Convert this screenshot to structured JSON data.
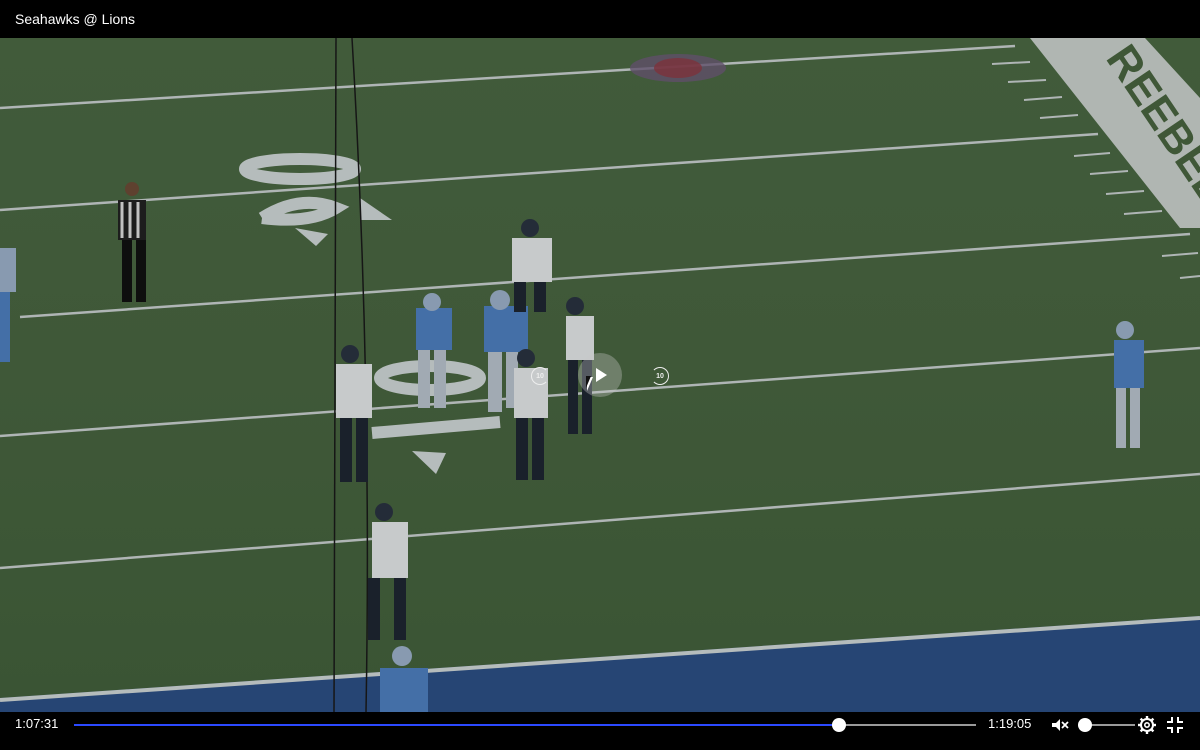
{
  "window": {
    "title": "Seahawks @ Lions"
  },
  "video": {
    "yard_marker_20": "20",
    "yard_marker_10": "10",
    "endzone_text": "REEBEB"
  },
  "overlay": {
    "seek_back_label": "10",
    "seek_forward_label": "10"
  },
  "controls": {
    "current_time": "1:07:31",
    "duration": "1:19:05",
    "progress_fraction": 0.848,
    "volume_fraction": 0.0,
    "muted": true
  },
  "icons": {
    "mute": "speaker-muted-icon",
    "settings": "gear-icon",
    "exit_fullscreen": "exit-fullscreen-icon",
    "play": "play-icon",
    "seek_back": "rewind-10-icon",
    "seek_forward": "forward-10-icon"
  },
  "colors": {
    "progress_accent": "#2b49ff",
    "field_green": "#47643f",
    "end_blue": "#2b4f86"
  }
}
